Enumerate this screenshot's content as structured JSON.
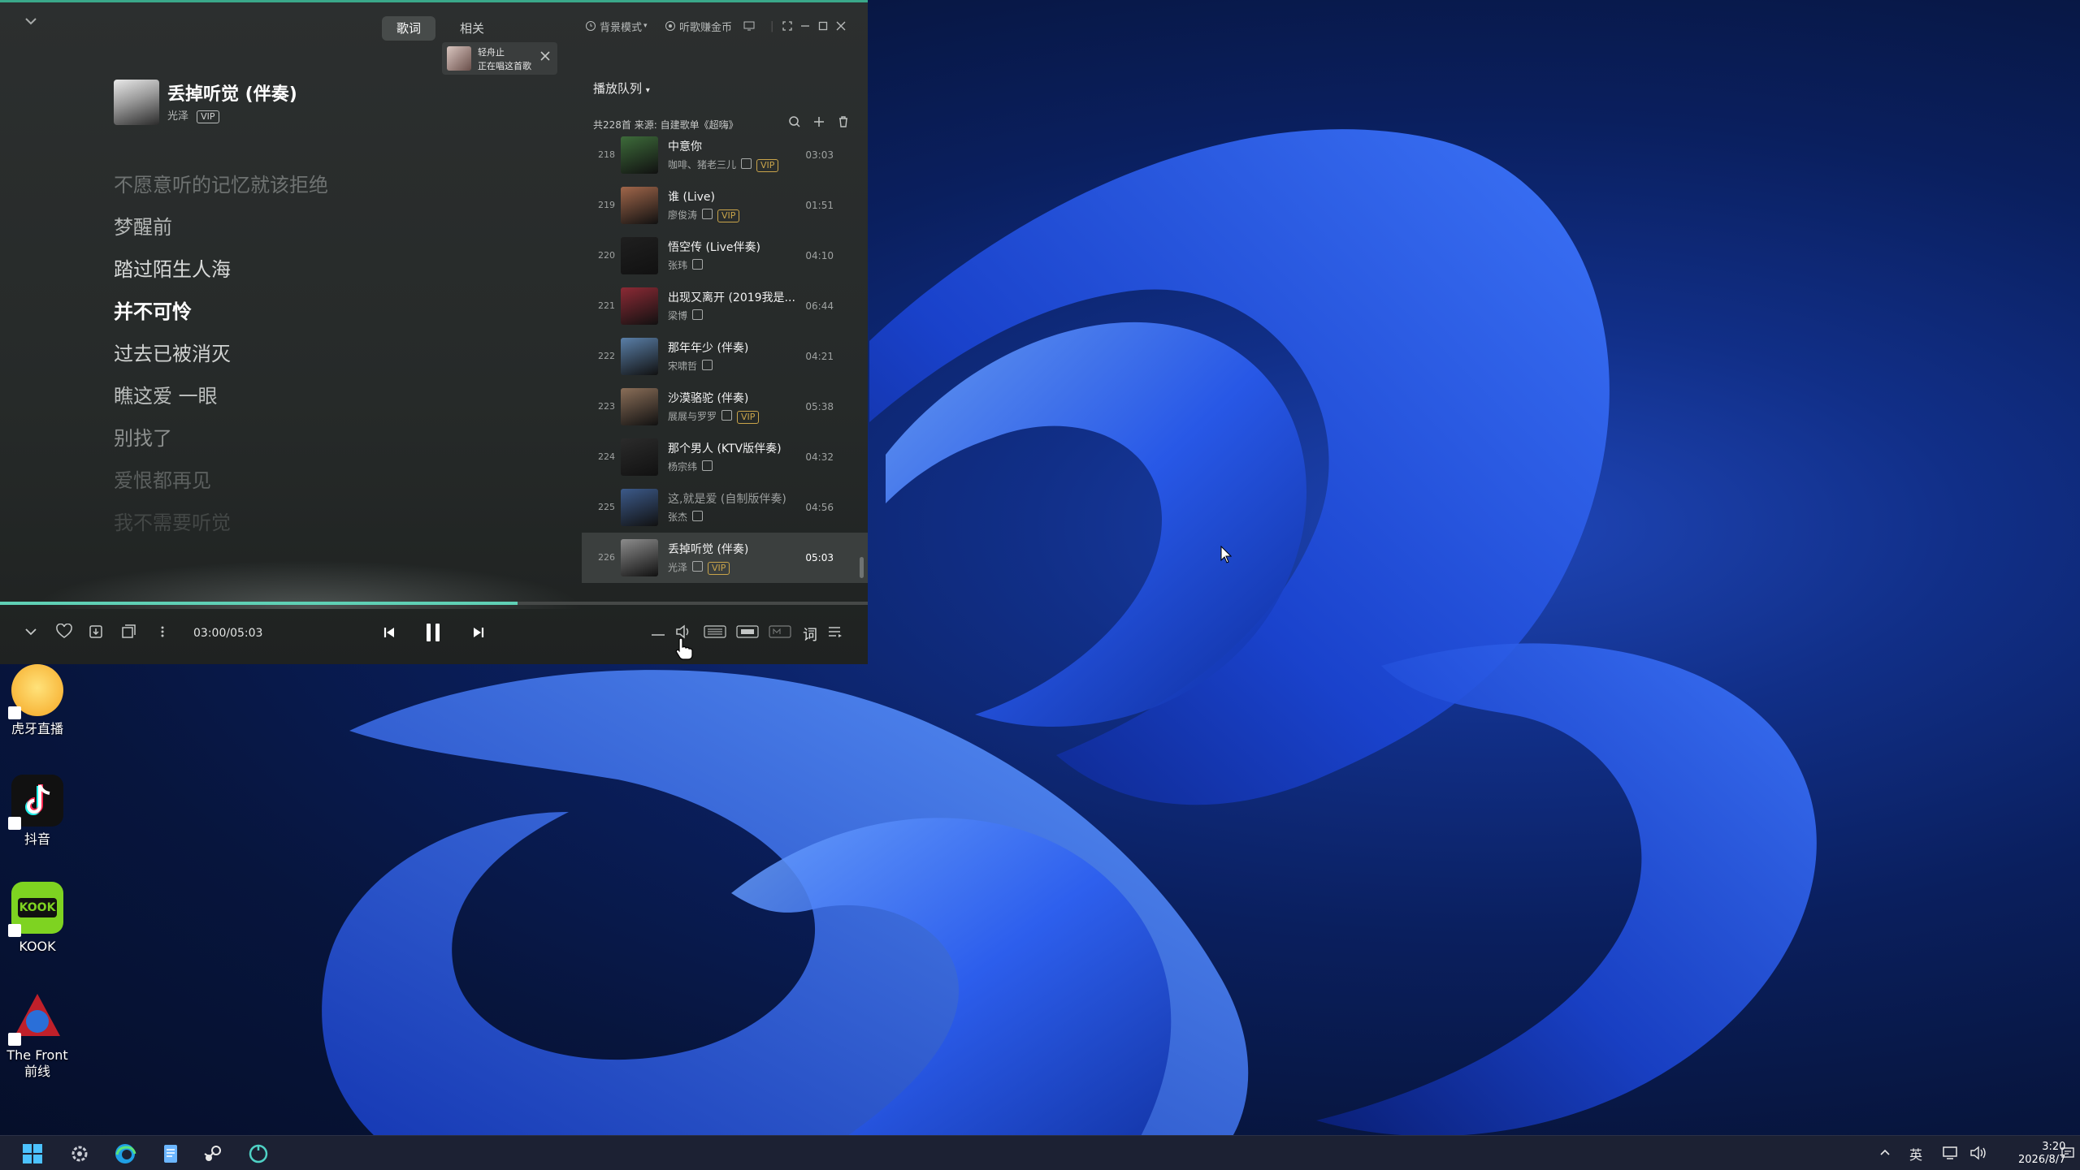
{
  "player": {
    "tabs": [
      {
        "label": "歌词"
      },
      {
        "label": "相关"
      }
    ],
    "header_controls": {
      "background_mode": "背景模式",
      "listen_earn": "听歌赚金币"
    },
    "notification": {
      "line1": "轻舟止",
      "line2": "正在唱这首歌"
    },
    "now_playing": {
      "title": "丢掉听觉 (伴奏)",
      "artist": "光泽",
      "badge": "VIP"
    },
    "lyrics": [
      {
        "text": "不愿意听的记忆就该拒绝",
        "state": "past"
      },
      {
        "text": "梦醒前",
        "state": "past"
      },
      {
        "text": "踏过陌生人海",
        "state": "past"
      },
      {
        "text": "并不可怜",
        "state": "current"
      },
      {
        "text": "过去已被消灭",
        "state": "next"
      },
      {
        "text": "瞧这爱 一眼",
        "state": "next"
      },
      {
        "text": "别找了",
        "state": "next"
      },
      {
        "text": "爱恨都再见",
        "state": "future"
      },
      {
        "text": "我不需要听觉",
        "state": "future"
      }
    ],
    "queue": {
      "title": "播放队列",
      "summary": "共228首   来源: 自建歌单《超嗨》",
      "items": [
        {
          "num": "218",
          "name": "中意你",
          "artist": "咖啡、猪老三儿",
          "vip": true,
          "duration": "03:03",
          "color": "#3d6b3a"
        },
        {
          "num": "219",
          "name": "谁 (Live)",
          "artist": "廖俊涛",
          "vip": true,
          "duration": "01:51",
          "color": "#a0664a"
        },
        {
          "num": "220",
          "name": "悟空传 (Live伴奏)",
          "artist": "张玮",
          "vip": false,
          "duration": "04:10",
          "color": "#1f1f1f"
        },
        {
          "num": "221",
          "name": "出现又离开 (2019我是...",
          "artist": "梁博",
          "vip": false,
          "duration": "06:44",
          "color": "#8c2a35"
        },
        {
          "num": "222",
          "name": "那年年少 (伴奏)",
          "artist": "宋啸哲",
          "vip": false,
          "duration": "04:21",
          "color": "#5a7fa8"
        },
        {
          "num": "223",
          "name": "沙漠骆驼 (伴奏)",
          "artist": "展展与罗罗",
          "vip": true,
          "duration": "05:38",
          "color": "#8a6e58"
        },
        {
          "num": "224",
          "name": "那个男人 (KTV版伴奏)",
          "artist": "杨宗纬",
          "vip": false,
          "duration": "04:32",
          "color": "#2b2b2b"
        },
        {
          "num": "225",
          "name": "这,就是爱 (自制版伴奏)",
          "artist": "张杰",
          "vip": false,
          "duration": "04:56",
          "color": "#3c5a8a",
          "dim": true
        },
        {
          "num": "226",
          "name": "丢掉听觉 (伴奏)",
          "artist": "光泽",
          "vip": true,
          "duration": "05:03",
          "color": "#8c8c8c",
          "current": true
        }
      ]
    },
    "playback": {
      "time": "03:00/05:03",
      "progress": 0.596
    },
    "lyrics_button": "词"
  },
  "desktop_icons": [
    {
      "label": "虎牙直播",
      "icon": "huya-icon"
    },
    {
      "label": "抖音",
      "icon": "douyin-icon"
    },
    {
      "label": "KOOK",
      "icon": "kook-icon"
    },
    {
      "label": "The Front 前线",
      "icon": "the-front-icon"
    }
  ],
  "taskbar": {
    "ime": "英",
    "clock_time": "3:20",
    "clock_date": "2026/8/7"
  },
  "colors": {
    "accent": "#5fd0b5",
    "vip_gold": "#c9a44a"
  }
}
